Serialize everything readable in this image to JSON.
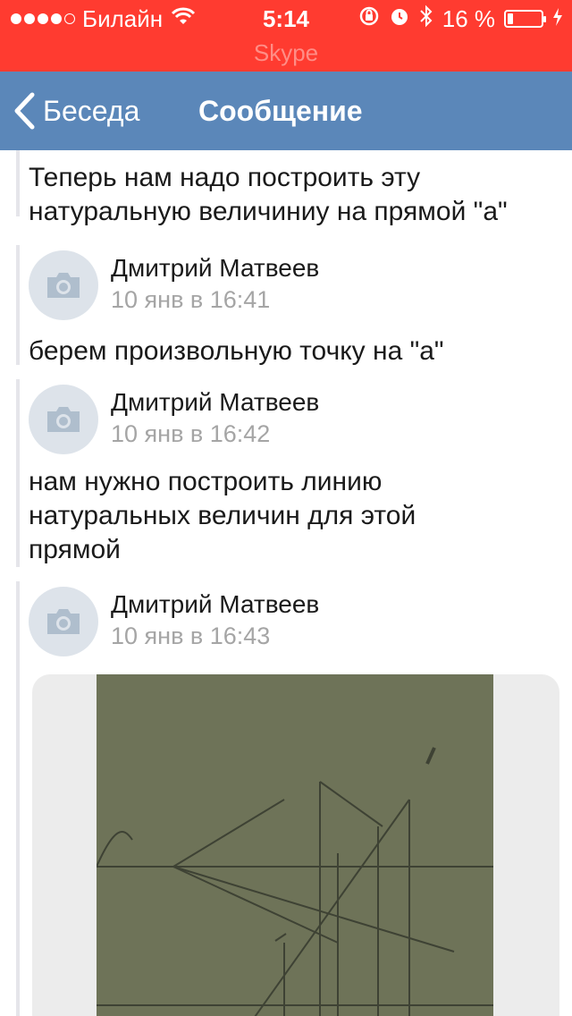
{
  "status_bar": {
    "carrier": "Билайн",
    "time": "5:14",
    "battery": "16 %",
    "battery_level": 0.16,
    "app_name": "Skype"
  },
  "nav": {
    "back_label": "Беседа",
    "title": "Сообщение"
  },
  "messages": [
    {
      "text": "Теперь нам надо построить эту натуральную величиниу на прямой \"а\""
    },
    {
      "sender": "Дмитрий Матвеев",
      "time": "10 янв в 16:41",
      "text": "берем произвольную точку на \"а\""
    },
    {
      "sender": "Дмитрий Матвеев",
      "time": "10 янв в 16:42",
      "text": "нам нужно построить линию натуральных величин для этой прямой"
    },
    {
      "sender": "Дмитрий Матвеев",
      "time": "10 янв в 16:43"
    }
  ],
  "colors": {
    "status_bar": "#ff3b30",
    "nav_bar": "#5b87b9",
    "timestamp": "#a5a5a5"
  }
}
